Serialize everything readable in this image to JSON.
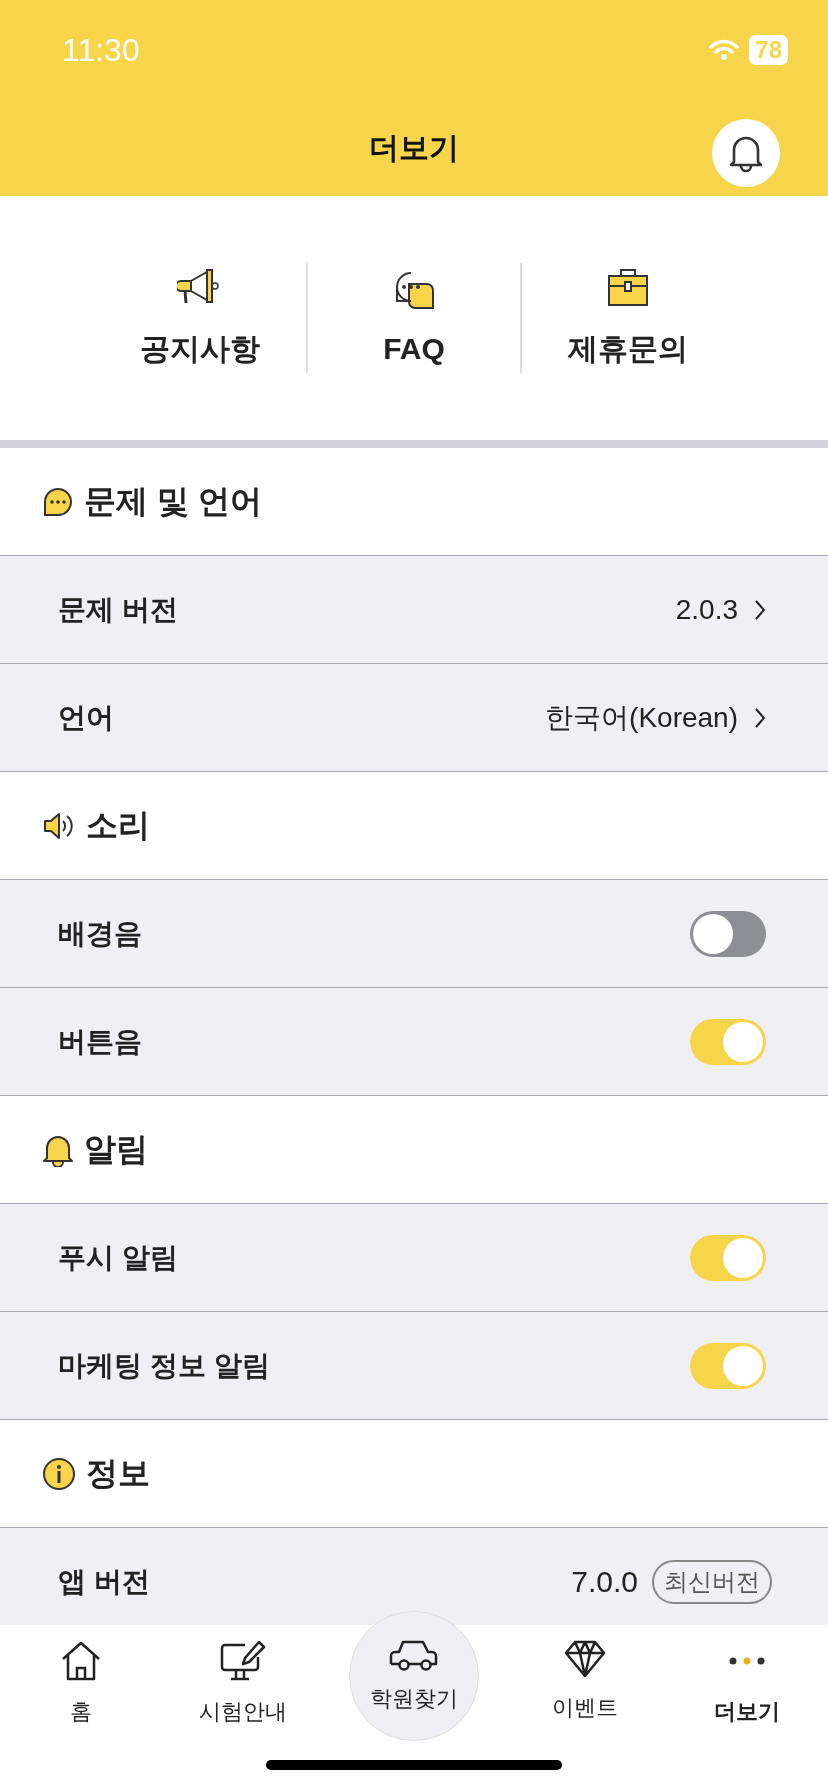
{
  "status_bar": {
    "time": "11:30",
    "battery": "78"
  },
  "header": {
    "title": "더보기"
  },
  "quick_menu": [
    {
      "label": "공지사항"
    },
    {
      "label": "FAQ"
    },
    {
      "label": "제휴문의"
    }
  ],
  "sections": [
    {
      "title": "문제 및 언어",
      "rows": [
        {
          "kind": "link",
          "label": "문제 버전",
          "value": "2.0.3"
        },
        {
          "kind": "link",
          "label": "언어",
          "value": "한국어(Korean)"
        }
      ]
    },
    {
      "title": "소리",
      "rows": [
        {
          "kind": "toggle",
          "label": "배경음",
          "on": false
        },
        {
          "kind": "toggle",
          "label": "버튼음",
          "on": true
        }
      ]
    },
    {
      "title": "알림",
      "rows": [
        {
          "kind": "toggle",
          "label": "푸시 알림",
          "on": true
        },
        {
          "kind": "toggle",
          "label": "마케팅 정보 알림",
          "on": true
        }
      ]
    },
    {
      "title": "정보",
      "rows": [
        {
          "kind": "version",
          "label": "앱 버전",
          "value": "7.0.0",
          "badge": "최신버전"
        }
      ]
    }
  ],
  "tab_bar": [
    {
      "label": "홈",
      "selected": false
    },
    {
      "label": "시험안내",
      "selected": false
    },
    {
      "label": "학원찾기",
      "selected": false
    },
    {
      "label": "이벤트",
      "selected": false
    },
    {
      "label": "더보기",
      "selected": true
    }
  ]
}
